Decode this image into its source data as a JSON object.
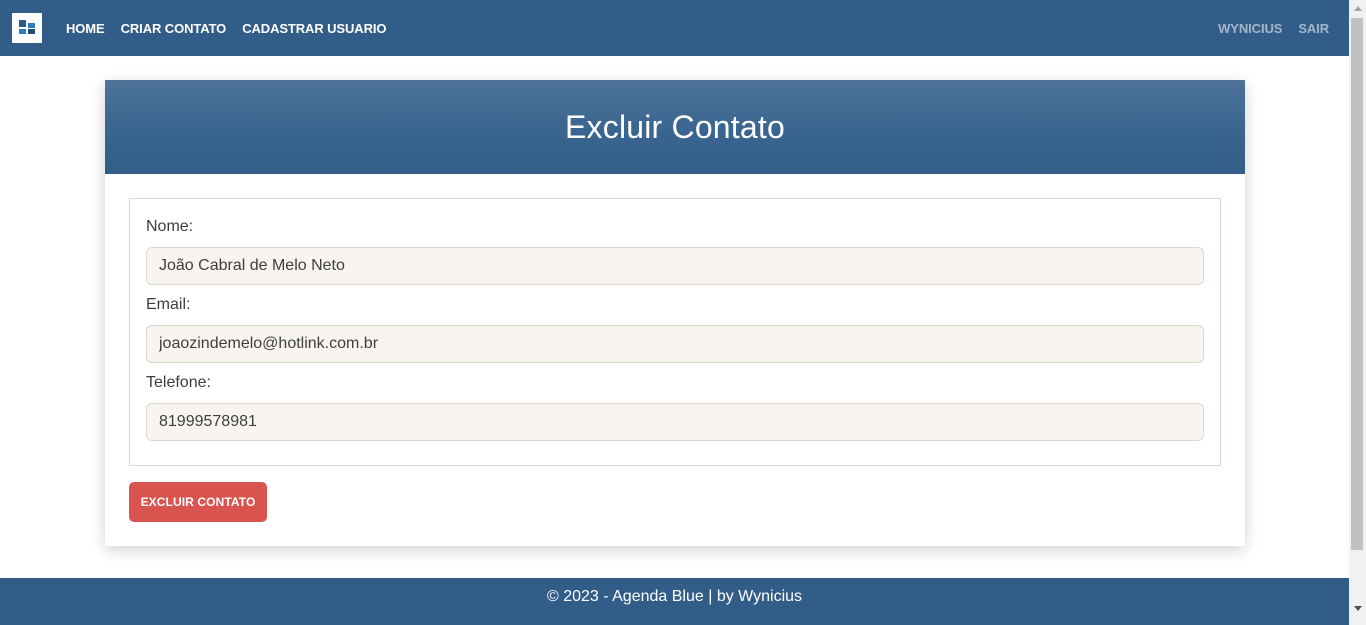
{
  "navbar": {
    "logo_icon": "app-logo-icon",
    "links": {
      "home": "HOME",
      "create_contact": "CRIAR CONTATO",
      "register_user": "CADASTRAR USUARIO"
    },
    "user": "WYNICIUS",
    "logout": "SAIR"
  },
  "card": {
    "title": "Excluir Contato",
    "fields": {
      "name_label": "Nome:",
      "name_value": "João Cabral de Melo Neto",
      "email_label": "Email:",
      "email_value": "joaozindemelo@hotlink.com.br",
      "phone_label": "Telefone:",
      "phone_value": "81999578981"
    },
    "delete_button": "EXCLUIR CONTATO"
  },
  "footer": {
    "text": "© 2023 - Agenda Blue | by Wynicius"
  },
  "colors": {
    "primary": "#325d88",
    "danger": "#d9534f",
    "input_bg": "#f8f5f0",
    "border": "#dfd7ca"
  }
}
